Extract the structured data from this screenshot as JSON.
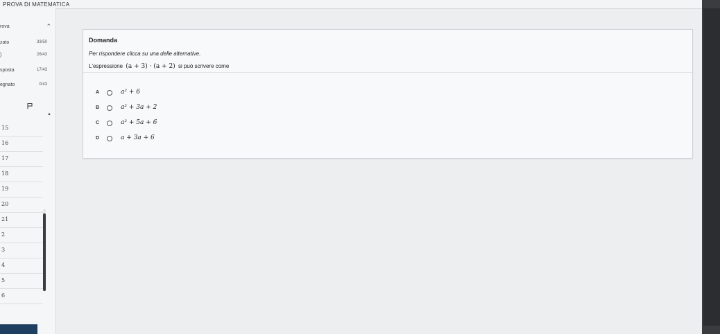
{
  "app": {
    "title": "PROVA DI MATEMATICA"
  },
  "sidebar": {
    "header": {
      "label": "rova",
      "chevron_icon": "chevron-up-icon"
    },
    "stats": [
      {
        "label": "zato",
        "value": "33/50"
      },
      {
        "label": ")",
        "value": "26/43"
      },
      {
        "label": "sposta",
        "value": "17/43"
      },
      {
        "label": "egnato",
        "value": "0/43"
      }
    ],
    "flag_icon": "flag-icon",
    "nav_arrow": "▲",
    "questions": [
      "15",
      "16",
      "17",
      "18",
      "19",
      "20",
      "21",
      "2",
      "3",
      "4",
      "5",
      "6"
    ]
  },
  "question": {
    "title": "Domanda",
    "instructions": "Per rispondere clicca su una delle alternative.",
    "stem_prefix": "L'espressione",
    "stem_math": "(a + 3) · (a + 2)",
    "stem_suffix": "si può scrivere come",
    "options": [
      {
        "letter": "A",
        "text": "a² + 6"
      },
      {
        "letter": "B",
        "text": "a² + 3a + 2"
      },
      {
        "letter": "C",
        "text": "a² + 5a + 6"
      },
      {
        "letter": "D",
        "text": "a + 3a + 6"
      }
    ]
  },
  "colors": {
    "accent": "#1f3f60",
    "scroll_thumb": "#3a3d40"
  }
}
